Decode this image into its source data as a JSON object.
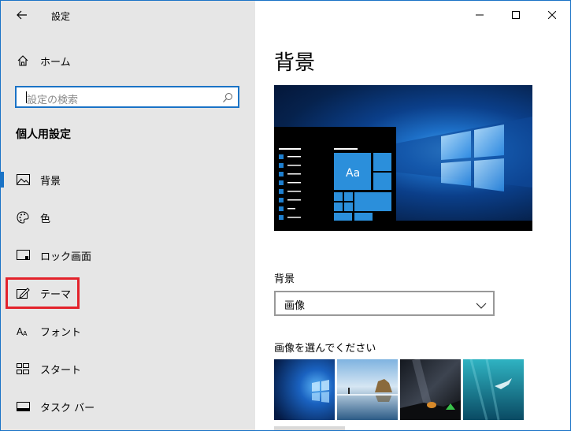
{
  "window": {
    "title": "設定",
    "controls": [
      "minimize",
      "maximize",
      "close"
    ]
  },
  "sidebar": {
    "home_label": "ホーム",
    "search": {
      "placeholder": "設定の検索"
    },
    "section_title": "個人用設定",
    "items": [
      {
        "label": "背景",
        "icon": "picture-icon",
        "selected": true
      },
      {
        "label": "色",
        "icon": "palette-icon",
        "selected": false
      },
      {
        "label": "ロック画面",
        "icon": "lock-screen-icon",
        "selected": false
      },
      {
        "label": "テーマ",
        "icon": "theme-icon",
        "selected": false,
        "highlighted": true
      },
      {
        "label": "フォント",
        "icon": "font-icon",
        "selected": false
      },
      {
        "label": "スタート",
        "icon": "start-icon",
        "selected": false
      },
      {
        "label": "タスク バー",
        "icon": "taskbar-icon",
        "selected": false
      }
    ]
  },
  "main": {
    "page_title": "背景",
    "preview": {
      "sample_text": "Aa"
    },
    "background_label": "背景",
    "background_select": {
      "value": "画像"
    },
    "choose_picture_label": "画像を選んでください",
    "thumbnails": [
      "windows-hero-blue",
      "beach-rocks-reflection",
      "night-sky-tent",
      "underwater-swimmer"
    ]
  },
  "colors": {
    "accent": "#1a73c6",
    "sidebar_bg": "#e6e6e6",
    "highlight_border": "#e3222b"
  }
}
